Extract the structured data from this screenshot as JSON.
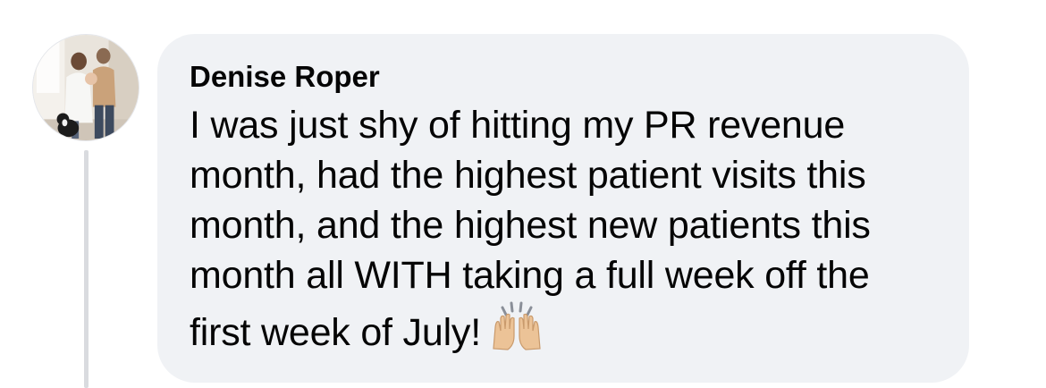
{
  "comment": {
    "author": "Denise Roper",
    "text": "I was just shy of hitting my PR revenue month, had the highest patient visits this month, and the highest new patients this month all WITH taking a full week off the first week of July!",
    "emoji": "raising-hands-icon"
  },
  "colors": {
    "bubble_background": "#f0f2f5",
    "text": "#050505",
    "thread_line": "#d9dbdf"
  }
}
